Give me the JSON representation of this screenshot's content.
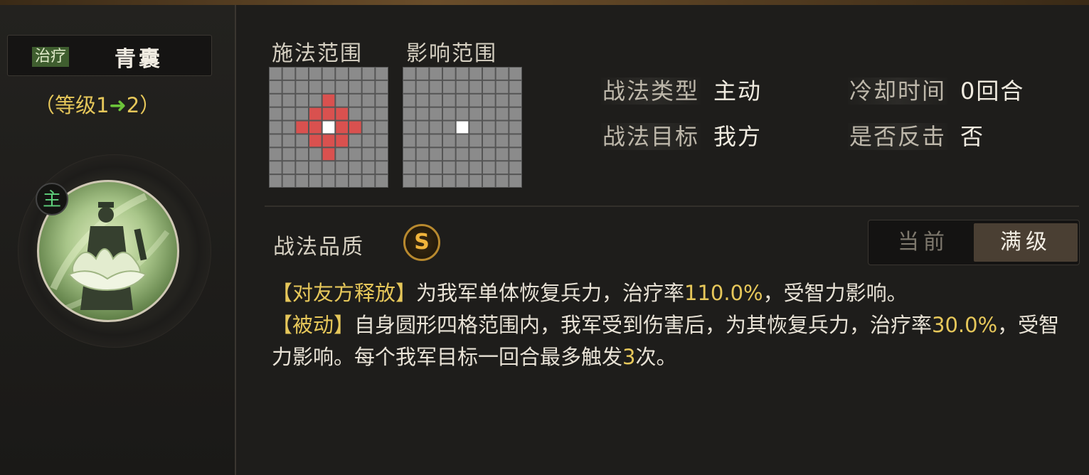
{
  "skill": {
    "category_tag": "治疗",
    "name": "青囊",
    "level_open": "（等级",
    "level_from": "1",
    "level_arrow": "➜",
    "level_to": "2",
    "level_close": "）",
    "commander_badge": "主"
  },
  "range": {
    "cast_title": "施法范围",
    "effect_title": "影响范围",
    "cast_cells": [
      [
        2,
        4
      ],
      [
        3,
        3
      ],
      [
        3,
        4
      ],
      [
        3,
        5
      ],
      [
        4,
        2
      ],
      [
        4,
        3
      ],
      [
        4,
        5
      ],
      [
        4,
        6
      ],
      [
        5,
        3
      ],
      [
        5,
        4
      ],
      [
        5,
        5
      ],
      [
        6,
        4
      ]
    ],
    "center": [
      4,
      4
    ],
    "colors": {
      "cell": "#8b8b8b",
      "line": "#555555",
      "highlight": "#d9514f",
      "center": "#ffffff"
    }
  },
  "attributes": {
    "type_label": "战法类型",
    "type_value": "主动",
    "cooldown_label": "冷却时间",
    "cooldown_value": "0回合",
    "target_label": "战法目标",
    "target_value": "我方",
    "counter_label": "是否反击",
    "counter_value": "否"
  },
  "quality": {
    "label": "战法品质",
    "grade": "S"
  },
  "toggle": {
    "current": "当前",
    "max": "满级"
  },
  "description": {
    "line1_bracket": "【对友方释放】",
    "line1_text": "为我军单体恢复兵力，治疗率",
    "line1_rate": "110.0%",
    "line1_tail": "，受智力影响。",
    "line2_bracket": "【被动】",
    "line2_text": "自身圆形四格范围内，我军受到伤害后，为其恢复兵力，治疗率",
    "line2_rate": "30.0%",
    "line2_mid": "，受智力影响。每个我军目标一回合最多触发",
    "line2_count": "3",
    "line2_tail": "次。"
  }
}
